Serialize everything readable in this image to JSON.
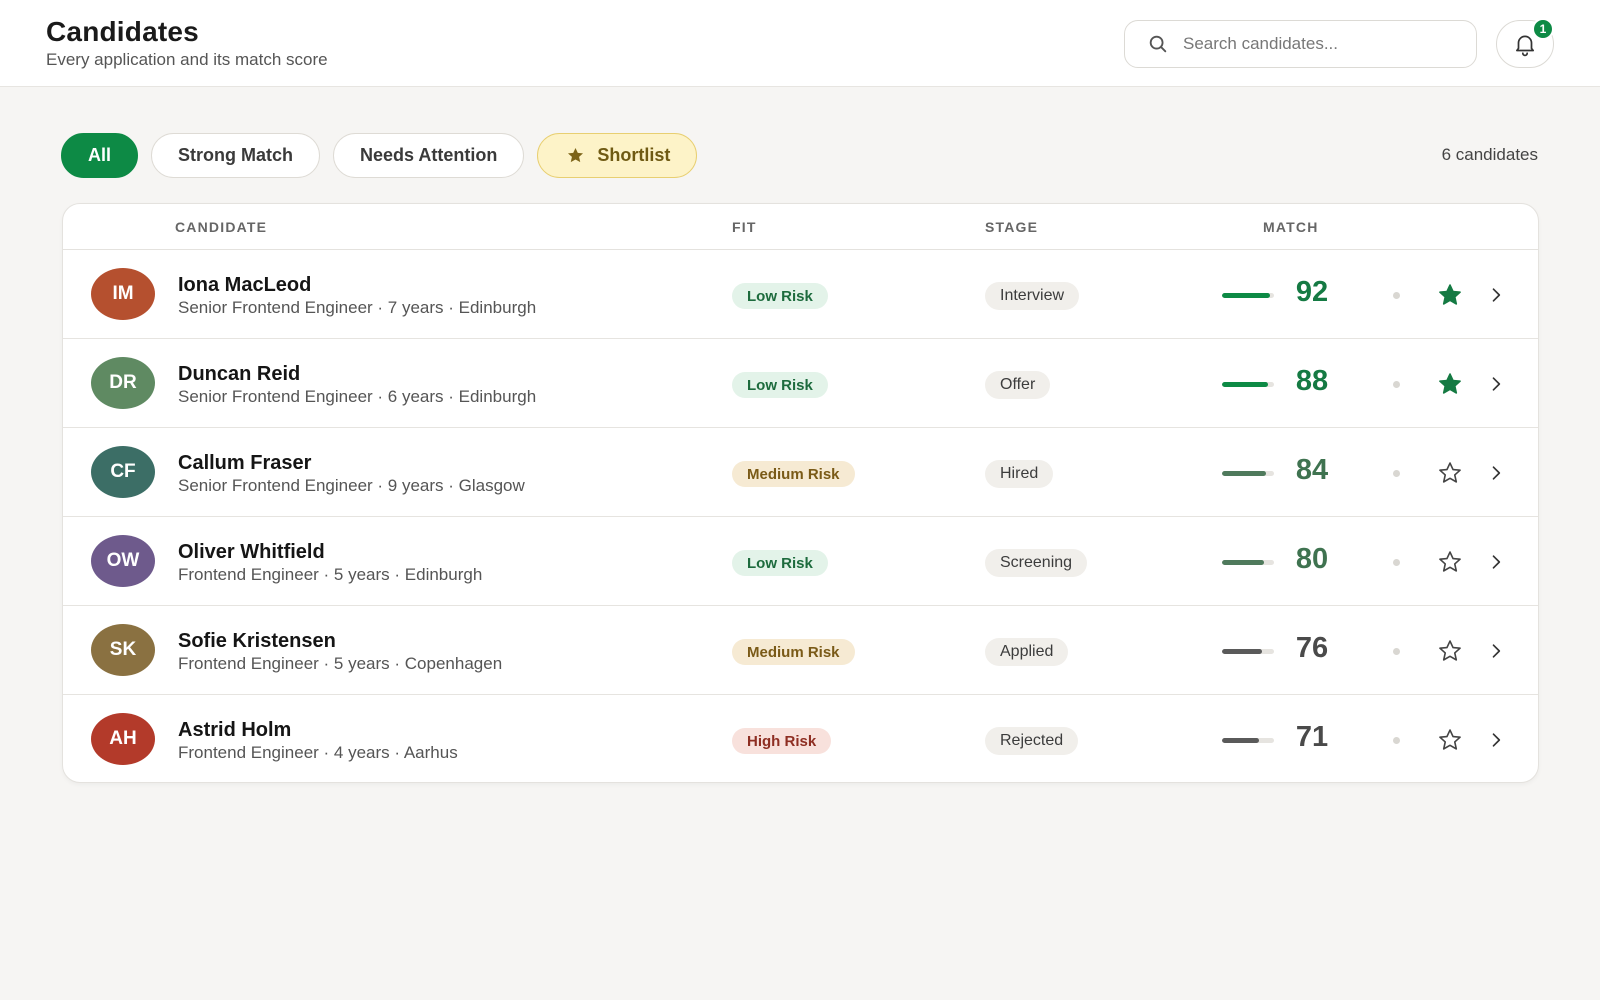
{
  "header": {
    "title": "Candidates",
    "subtitle": "Every application and its match score",
    "search_placeholder": "Search candidates...",
    "notification_count": "1"
  },
  "filters": [
    {
      "label": "All",
      "active": true
    },
    {
      "label": "Strong Match",
      "active": false
    },
    {
      "label": "Needs Attention",
      "active": false
    },
    {
      "label": "Shortlist",
      "active": false,
      "icon": "star-icon"
    }
  ],
  "candidate_count": "6 candidates",
  "table": {
    "columns": {
      "candidate": "CANDIDATE",
      "fit": "FIT",
      "stage": "STAGE",
      "match": "MATCH"
    },
    "rows": [
      {
        "initials": "IM",
        "name": "Iona MacLeod",
        "meta": "Senior Frontend Engineer · 7 years · Edinburgh",
        "fit": "Low Risk",
        "stage": "Interview",
        "match": "92",
        "shortlisted": true,
        "avatar_color": "#b5502f",
        "fit_bg": "#e3f3e9",
        "fit_color": "#1d6b3d",
        "score_color": "#157a43",
        "bar_color": "#0d8a45"
      },
      {
        "initials": "DR",
        "name": "Duncan Reid",
        "meta": "Senior Frontend Engineer · 6 years · Edinburgh",
        "fit": "Low Risk",
        "stage": "Offer",
        "match": "88",
        "shortlisted": true,
        "avatar_color": "#5f8a62",
        "fit_bg": "#e3f3e9",
        "fit_color": "#1d6b3d",
        "score_color": "#157a43",
        "bar_color": "#0d8a45"
      },
      {
        "initials": "CF",
        "name": "Callum Fraser",
        "meta": "Senior Frontend Engineer · 9 years · Glasgow",
        "fit": "Medium Risk",
        "stage": "Hired",
        "match": "84",
        "shortlisted": false,
        "avatar_color": "#3c6e66",
        "fit_bg": "#f6ead3",
        "fit_color": "#7a5a17",
        "score_color": "#3f7350",
        "bar_color": "#4f7a5c"
      },
      {
        "initials": "OW",
        "name": "Oliver Whitfield",
        "meta": "Frontend Engineer · 5 years · Edinburgh",
        "fit": "Low Risk",
        "stage": "Screening",
        "match": "80",
        "shortlisted": false,
        "avatar_color": "#6e5a8c",
        "fit_bg": "#e3f3e9",
        "fit_color": "#1d6b3d",
        "score_color": "#3f7350",
        "bar_color": "#4f7a5c"
      },
      {
        "initials": "SK",
        "name": "Sofie Kristensen",
        "meta": "Frontend Engineer · 5 years · Copenhagen",
        "fit": "Medium Risk",
        "stage": "Applied",
        "match": "76",
        "shortlisted": false,
        "avatar_color": "#8a7141",
        "fit_bg": "#f6ead3",
        "fit_color": "#7a5a17",
        "score_color": "#4a4a4a",
        "bar_color": "#5a5a5a"
      },
      {
        "initials": "AH",
        "name": "Astrid Holm",
        "meta": "Frontend Engineer · 4 years · Aarhus",
        "fit": "High Risk",
        "stage": "Rejected",
        "match": "71",
        "shortlisted": false,
        "avatar_color": "#b33a2a",
        "fit_bg": "#f8e1dc",
        "fit_color": "#8e2e22",
        "score_color": "#4a4a4a",
        "bar_color": "#5a5a5a"
      }
    ]
  },
  "colors": {
    "accent": "#0d8a45",
    "shortlist_bg": "#fdf3c8",
    "page_bg": "#f6f5f3"
  }
}
